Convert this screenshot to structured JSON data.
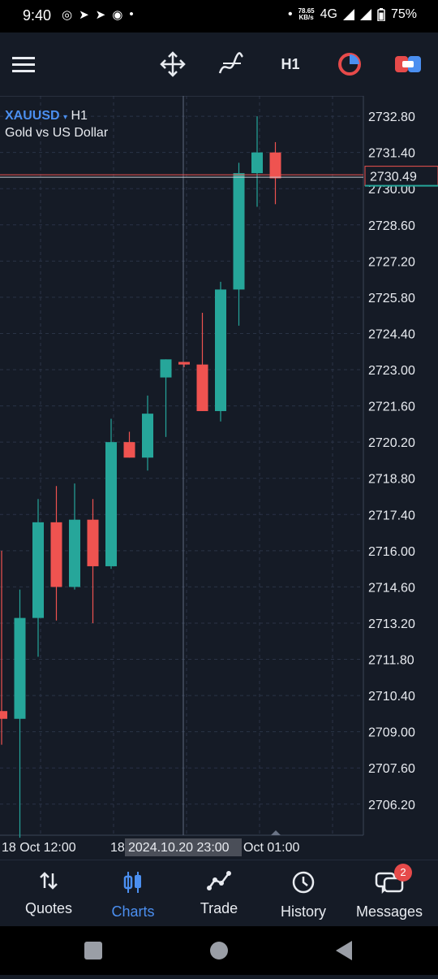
{
  "status_bar": {
    "time": "9:40",
    "net_speed_value": "78.65",
    "net_speed_unit": "KB/s",
    "network": "4G",
    "battery": "75%"
  },
  "toolbar": {
    "timeframe": "H1",
    "icons": [
      "menu-icon",
      "crosshair-move-icon",
      "indicators-icon",
      "timeframe",
      "chart-type-icon",
      "trade-icon"
    ]
  },
  "symbol": {
    "name": "XAUUSD",
    "arrow": "▾",
    "timeframe": "H1",
    "description": "Gold vs US Dollar"
  },
  "price_axis": {
    "labels": [
      "2732.80",
      "2731.40",
      "2730.00",
      "2728.60",
      "2727.20",
      "2725.80",
      "2724.40",
      "2723.00",
      "2721.60",
      "2720.20",
      "2718.80",
      "2717.40",
      "2716.00",
      "2714.60",
      "2713.20",
      "2711.80",
      "2710.40",
      "2709.00",
      "2707.60",
      "2706.20"
    ],
    "current_price": "2730.49"
  },
  "time_axis": {
    "left_label": "18 Oct 12:00",
    "partial_label": "18",
    "crosshair_label": "2024.10.20 23:00",
    "right_label": "Oct 01:00"
  },
  "chart_data": {
    "type": "candlestick",
    "symbol": "XAUUSD",
    "timeframe": "H1",
    "colors": {
      "up": "#26a69a",
      "down": "#ef5350",
      "background": "#151b26",
      "grid": "#2a3346"
    },
    "ylim": [
      2705.0,
      2733.4
    ],
    "candles": [
      {
        "o": 2709.8,
        "h": 2716.0,
        "l": 2708.5,
        "c": 2709.5
      },
      {
        "o": 2709.5,
        "h": 2714.5,
        "l": 2704.9,
        "c": 2713.4
      },
      {
        "o": 2713.4,
        "h": 2718.0,
        "l": 2711.9,
        "c": 2717.1
      },
      {
        "o": 2717.1,
        "h": 2718.5,
        "l": 2713.3,
        "c": 2714.6
      },
      {
        "o": 2714.6,
        "h": 2718.6,
        "l": 2714.5,
        "c": 2717.2
      },
      {
        "o": 2717.2,
        "h": 2718.0,
        "l": 2713.2,
        "c": 2715.4
      },
      {
        "o": 2715.4,
        "h": 2721.1,
        "l": 2715.3,
        "c": 2720.2
      },
      {
        "o": 2720.2,
        "h": 2720.6,
        "l": 2719.6,
        "c": 2719.6
      },
      {
        "o": 2719.6,
        "h": 2722.0,
        "l": 2719.1,
        "c": 2721.3
      },
      {
        "o": 2722.7,
        "h": 2723.4,
        "l": 2720.4,
        "c": 2723.4
      },
      {
        "o": 2723.3,
        "h": 2723.3,
        "l": 2723.1,
        "c": 2723.2
      },
      {
        "o": 2723.2,
        "h": 2725.2,
        "l": 2721.4,
        "c": 2721.4
      },
      {
        "o": 2721.4,
        "h": 2726.4,
        "l": 2721.0,
        "c": 2726.1
      },
      {
        "o": 2726.1,
        "h": 2731.0,
        "l": 2724.7,
        "c": 2730.6
      },
      {
        "o": 2730.6,
        "h": 2732.8,
        "l": 2729.3,
        "c": 2731.4
      },
      {
        "o": 2731.4,
        "h": 2731.8,
        "l": 2729.4,
        "c": 2730.4
      }
    ]
  },
  "bottom_nav": {
    "items": [
      {
        "label": "Quotes",
        "icon": "quotes-icon"
      },
      {
        "label": "Charts",
        "icon": "charts-icon"
      },
      {
        "label": "Trade",
        "icon": "trade-icon"
      },
      {
        "label": "History",
        "icon": "history-icon"
      },
      {
        "label": "Messages",
        "icon": "messages-icon",
        "badge": "2"
      }
    ],
    "active": "Charts"
  }
}
